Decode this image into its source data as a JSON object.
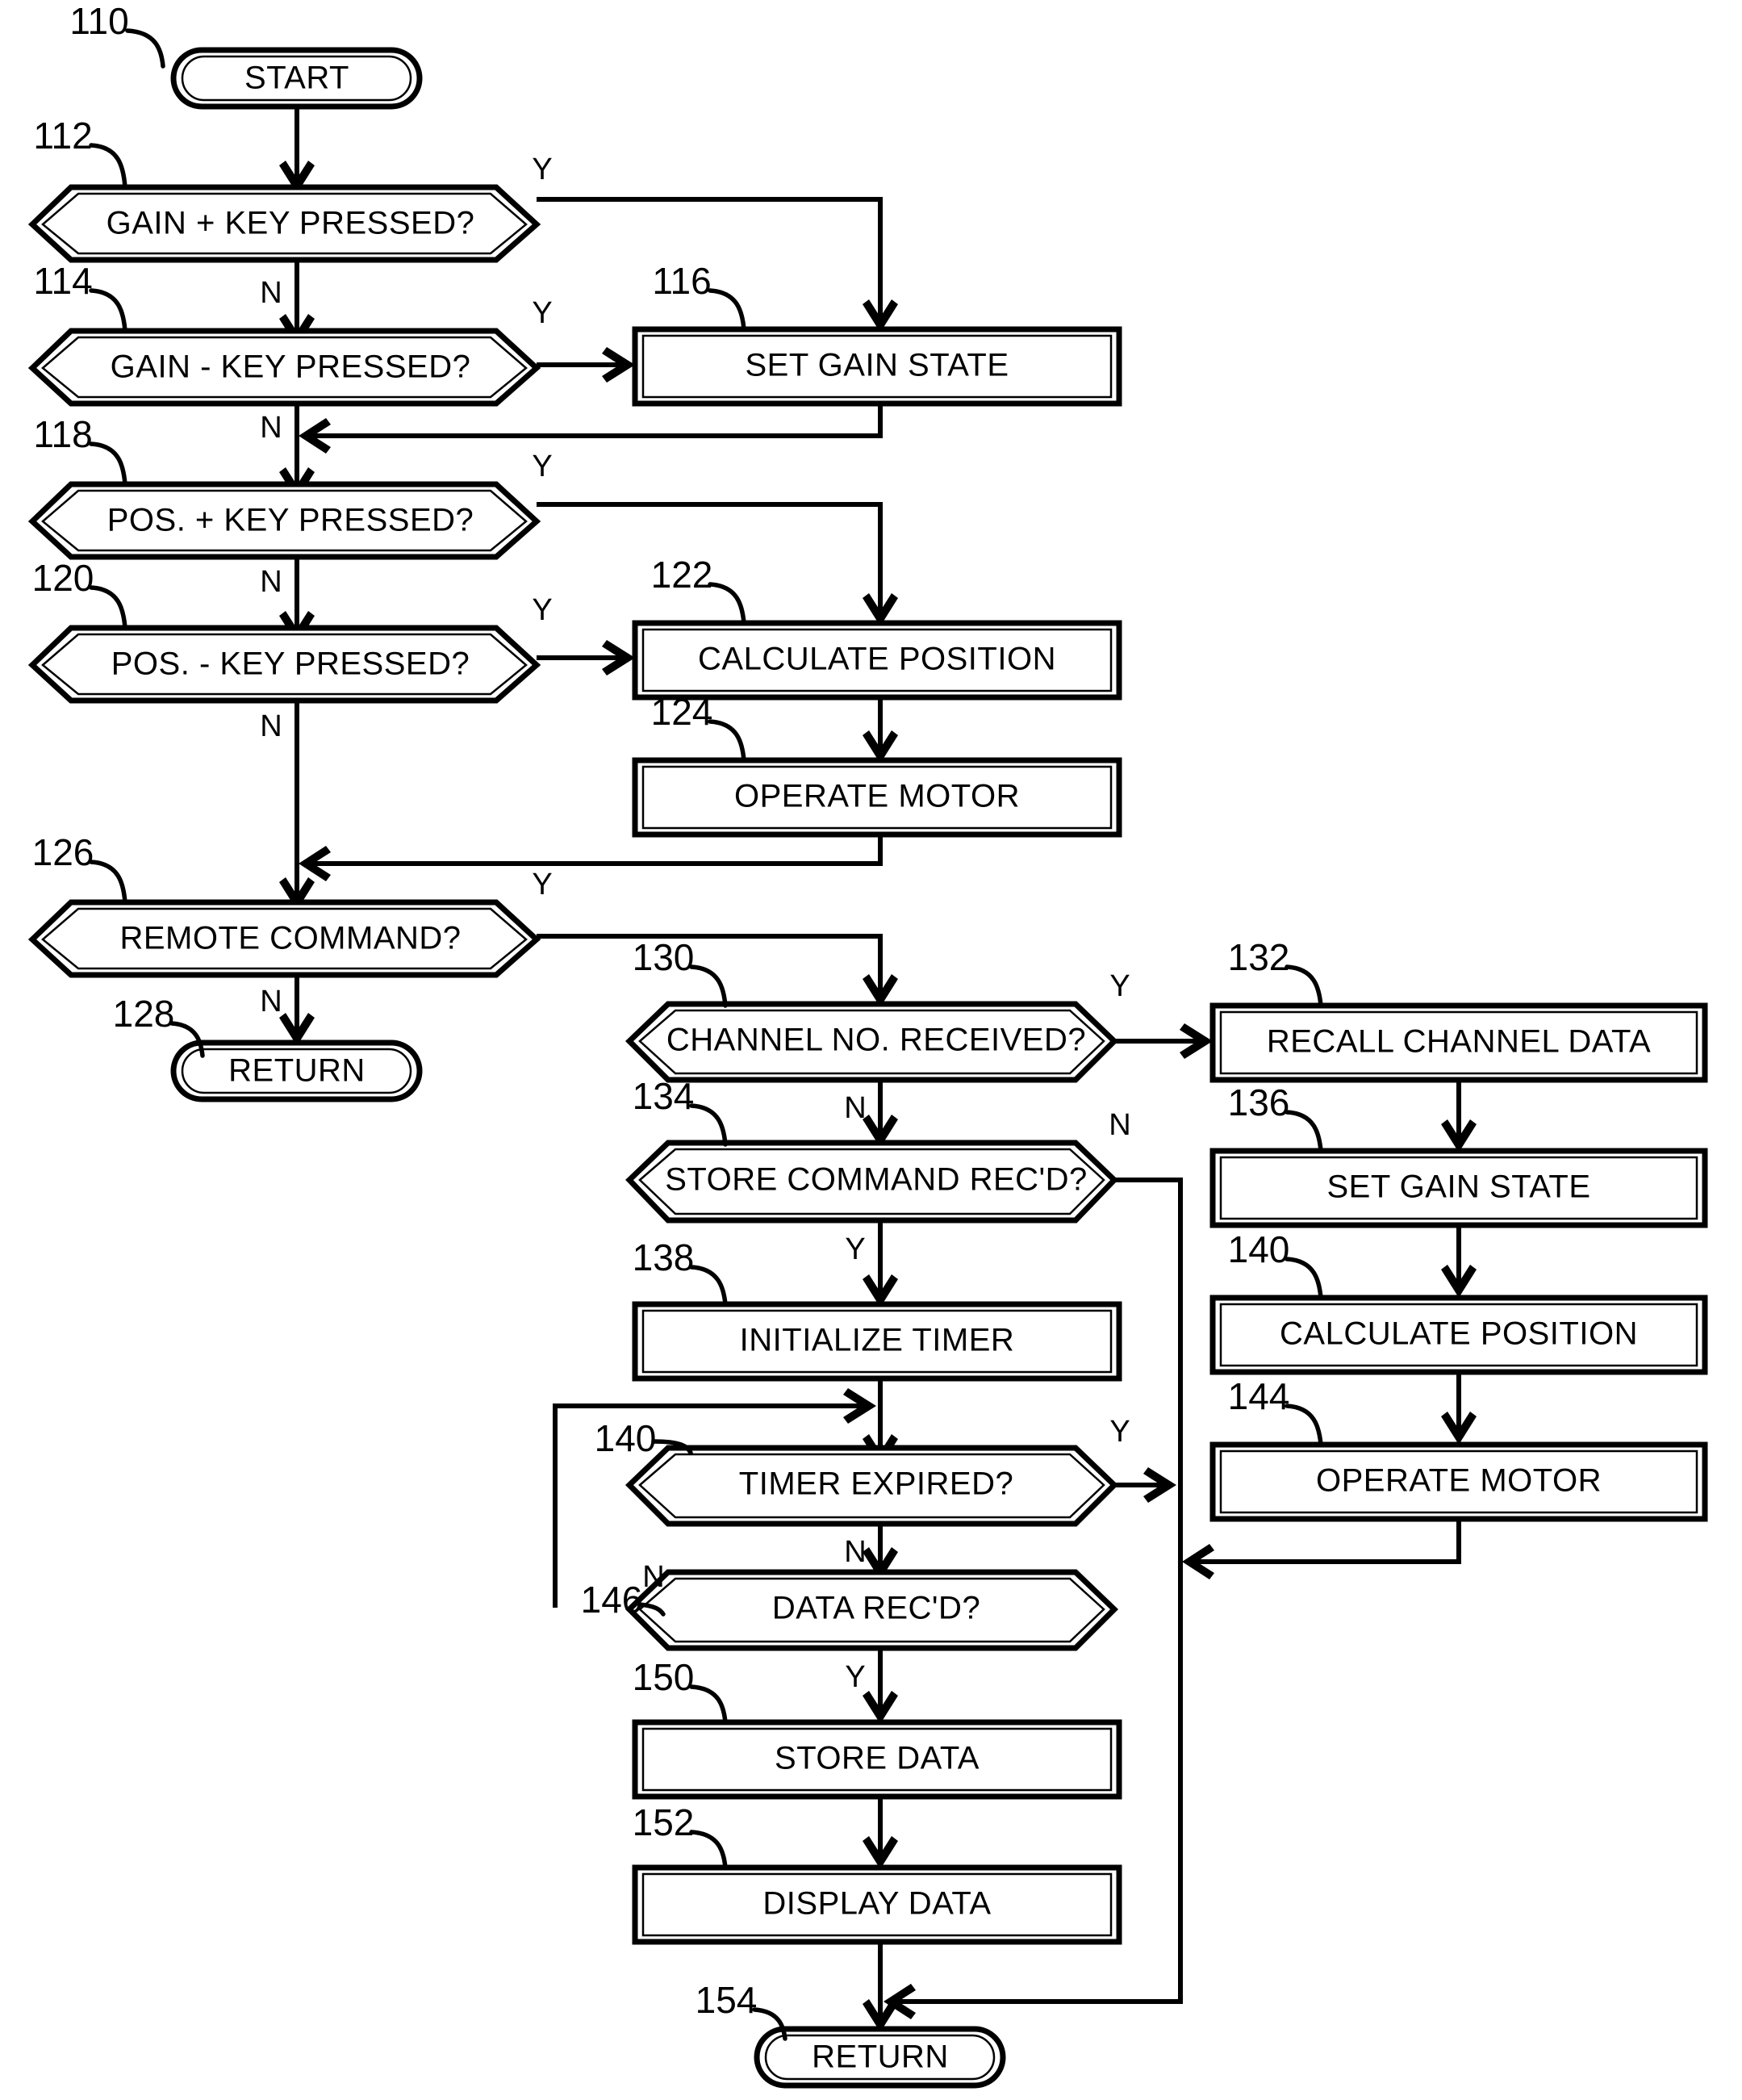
{
  "figure": {
    "type": "patent-flowchart",
    "title": "",
    "terminators": [
      {
        "ref": "110",
        "label": "START"
      },
      {
        "ref": "128",
        "label": "RETURN"
      },
      {
        "ref": "154",
        "label": "RETURN"
      }
    ],
    "decisions": [
      {
        "ref": "112",
        "label": "GAIN + KEY PRESSED?",
        "yes": "Y",
        "no": "N"
      },
      {
        "ref": "114",
        "label": "GAIN - KEY PRESSED?",
        "yes": "Y",
        "no": "N"
      },
      {
        "ref": "118",
        "label": "POS. +  KEY PRESSED?",
        "yes": "Y",
        "no": "N"
      },
      {
        "ref": "120",
        "label": "POS. -  KEY PRESSED?",
        "yes": "Y",
        "no": "N"
      },
      {
        "ref": "126",
        "label": "REMOTE COMMAND?",
        "yes": "Y",
        "no": "N"
      },
      {
        "ref": "130",
        "label": "CHANNEL NO. RECEIVED?",
        "yes": "Y",
        "no": "N"
      },
      {
        "ref": "134",
        "label": "STORE COMMAND REC'D?",
        "yes": "Y",
        "no": "N"
      },
      {
        "ref": "140",
        "label": "TIMER EXPIRED?",
        "yes": "Y",
        "no": "N"
      },
      {
        "ref": "146",
        "label": "DATA REC'D?",
        "yes": "Y",
        "no": "N"
      }
    ],
    "processes": [
      {
        "ref": "116",
        "label": "SET GAIN STATE"
      },
      {
        "ref": "122",
        "label": "CALCULATE POSITION"
      },
      {
        "ref": "124",
        "label": "OPERATE MOTOR"
      },
      {
        "ref": "132",
        "label": "RECALL CHANNEL DATA"
      },
      {
        "ref": "136",
        "label": "SET GAIN STATE"
      },
      {
        "ref": "140b",
        "label": "CALCULATE POSITION",
        "ref_text": "140"
      },
      {
        "ref": "144",
        "label": "OPERATE MOTOR"
      },
      {
        "ref": "138",
        "label": "INITIALIZE TIMER"
      },
      {
        "ref": "150",
        "label": "STORE DATA"
      },
      {
        "ref": "152",
        "label": "DISPLAY DATA"
      }
    ],
    "nodes": {
      "n110": {
        "ref": "110",
        "label": "START"
      },
      "n112": {
        "ref": "112",
        "label": "GAIN + KEY PRESSED?"
      },
      "n114": {
        "ref": "114",
        "label": "GAIN - KEY PRESSED?"
      },
      "n116": {
        "ref": "116",
        "label": "SET GAIN STATE"
      },
      "n118": {
        "ref": "118",
        "label": "POS. +  KEY PRESSED?"
      },
      "n120": {
        "ref": "120",
        "label": "POS. -  KEY PRESSED?"
      },
      "n122": {
        "ref": "122",
        "label": "CALCULATE POSITION"
      },
      "n124": {
        "ref": "124",
        "label": "OPERATE MOTOR"
      },
      "n126": {
        "ref": "126",
        "label": "REMOTE COMMAND?"
      },
      "n128": {
        "ref": "128",
        "label": "RETURN"
      },
      "n130": {
        "ref": "130",
        "label": "CHANNEL NO. RECEIVED?"
      },
      "n132": {
        "ref": "132",
        "label": "RECALL CHANNEL DATA"
      },
      "n134": {
        "ref": "134",
        "label": "STORE COMMAND REC'D?"
      },
      "n136": {
        "ref": "136",
        "label": "SET GAIN STATE"
      },
      "n138": {
        "ref": "138",
        "label": "INITIALIZE TIMER"
      },
      "n140r": {
        "ref": "140",
        "label": "CALCULATE POSITION"
      },
      "n140d": {
        "ref": "140",
        "label": "TIMER EXPIRED?"
      },
      "n144": {
        "ref": "144",
        "label": "OPERATE MOTOR"
      },
      "n146": {
        "ref": "146",
        "label": "DATA REC'D?"
      },
      "n150": {
        "ref": "150",
        "label": "STORE DATA"
      },
      "n152": {
        "ref": "152",
        "label": "DISPLAY DATA"
      },
      "n154": {
        "ref": "154",
        "label": "RETURN"
      }
    },
    "branch_labels": {
      "y112": "Y",
      "n112": "N",
      "y114": "Y",
      "n114": "N",
      "y118": "Y",
      "n118": "N",
      "y120": "Y",
      "n120": "N",
      "y126": "Y",
      "n126": "N",
      "y130": "Y",
      "n130": "N",
      "n134": "N",
      "y134": "Y",
      "y140": "Y",
      "n140": "N",
      "n146": "N",
      "y146": "Y"
    },
    "colors": {
      "ink": "#000000",
      "paper": "#ffffff"
    }
  }
}
